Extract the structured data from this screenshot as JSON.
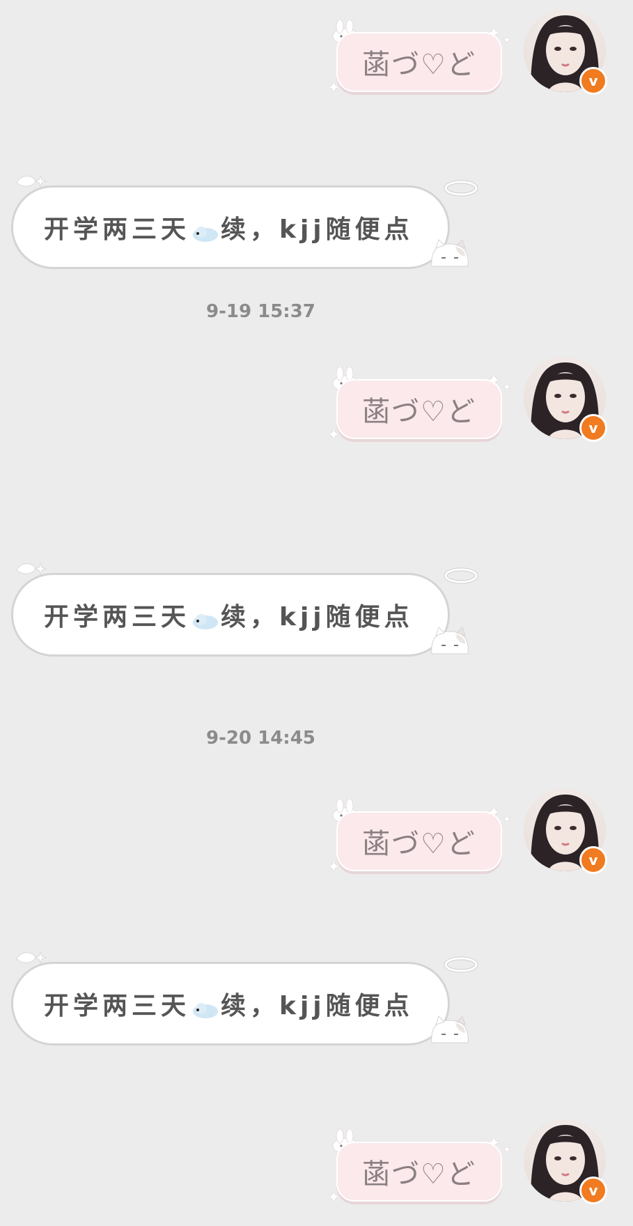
{
  "messages": [
    {
      "type": "out",
      "text": "菡づ♡ど",
      "badge": "v"
    },
    {
      "type": "in",
      "text_before": "开学两三天",
      "text_after": "续，kjj随便点"
    },
    {
      "type": "time",
      "text": "9-19  15:37"
    },
    {
      "type": "out",
      "text": "菡づ♡ど",
      "badge": "v"
    },
    {
      "type": "in",
      "text_before": "开学两三天",
      "text_after": "续，kjj随便点"
    },
    {
      "type": "time",
      "text": "9-20  14:45"
    },
    {
      "type": "out",
      "text": "菡づ♡ど",
      "badge": "v"
    },
    {
      "type": "in",
      "text_before": "开学两三天",
      "text_after": "续，kjj随便点"
    },
    {
      "type": "out",
      "text": "菡づ♡ど",
      "badge": "v"
    }
  ],
  "icons": {
    "bubble_cloud": "cloud-emoji-icon",
    "avatar": "avatar",
    "verified": "verified-badge-icon"
  },
  "colors": {
    "background": "#ececec",
    "bubble_out": "#fbe9ec",
    "bubble_in": "#ffffff",
    "badge": "#f07b20",
    "text_in": "#555555",
    "text_out": "#8a7f82",
    "timestamp": "#8b8b8b"
  }
}
